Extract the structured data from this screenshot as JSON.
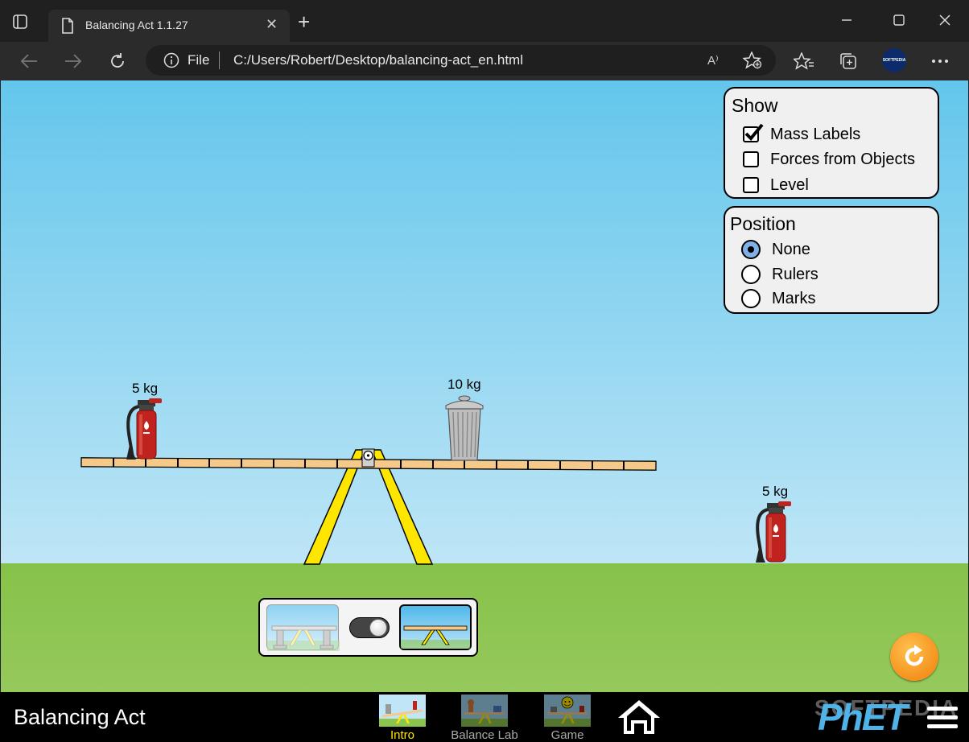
{
  "browser": {
    "tab_title": "Balancing Act 1.1.27",
    "address_scheme": "File",
    "address_url": "C:/Users/Robert/Desktop/balancing-act_en.html",
    "read_aloud": "A⁾",
    "profile_label": "SOFTPEDIA"
  },
  "show_panel": {
    "title": "Show",
    "options": [
      {
        "label": "Mass Labels",
        "checked": true
      },
      {
        "label": "Forces from Objects",
        "checked": false
      },
      {
        "label": "Level",
        "checked": false
      }
    ]
  },
  "position_panel": {
    "title": "Position",
    "options": [
      {
        "label": "None",
        "selected": true
      },
      {
        "label": "Rulers",
        "selected": false
      },
      {
        "label": "Marks",
        "selected": false
      }
    ]
  },
  "objects": {
    "plank_extinguisher_label": "5 kg",
    "trash_can_label": "10 kg",
    "ground_extinguisher_label": "5 kg"
  },
  "supports": {
    "mode": "removed"
  },
  "navbar": {
    "sim_title": "Balancing Act",
    "screens": [
      {
        "label": "Intro",
        "active": true
      },
      {
        "label": "Balance Lab",
        "active": false
      },
      {
        "label": "Game",
        "active": false
      }
    ],
    "logo": "PhET",
    "watermark": "SOFTPEDIA"
  },
  "colors": {
    "sky_top": "#64c6ec",
    "ground": "#8cc450",
    "fulcrum": "#ffe600",
    "plank": "#f4c98a",
    "extinguisher": "#c0221d",
    "reset": "#f5921e",
    "active_screen": "#ffe600"
  }
}
